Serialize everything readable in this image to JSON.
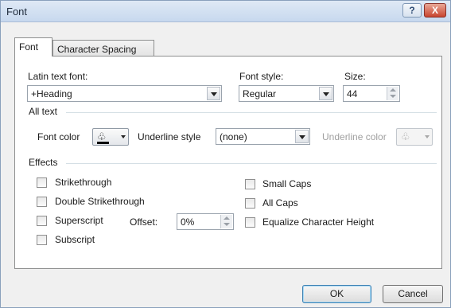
{
  "window": {
    "title": "Font",
    "help_label": "?",
    "close_label": "X"
  },
  "tabs": [
    {
      "label": "Font",
      "mnemonic": "n"
    },
    {
      "label": "Character Spacing",
      "mnemonic": "r"
    }
  ],
  "font": {
    "latin_label": "Latin text font:",
    "latin_value": "+Heading",
    "style_label": "Font style:",
    "style_value": "Regular",
    "size_label": "Size:",
    "size_value": "44"
  },
  "all_text": {
    "section_label": "All text",
    "font_color_label": "Font color",
    "underline_style_label": "Underline style",
    "underline_style_value": "(none)",
    "underline_color_label": "Underline color"
  },
  "effects": {
    "section_label": "Effects",
    "items": [
      {
        "label": "Strikethrough",
        "checked": false
      },
      {
        "label": "Double Strikethrough",
        "checked": false
      },
      {
        "label": "Superscript",
        "checked": false
      },
      {
        "label": "Subscript",
        "checked": false
      },
      {
        "label": "Small Caps",
        "checked": false
      },
      {
        "label": "All Caps",
        "checked": false
      },
      {
        "label": "Equalize Character Height",
        "checked": false
      }
    ],
    "offset_label": "Offset:",
    "offset_value": "0%"
  },
  "buttons": {
    "ok": "OK",
    "cancel": "Cancel"
  },
  "colors": {
    "font_color_swatch": "#000000",
    "close_red": "#c8442f"
  },
  "icons": {
    "font_color": "paint-bucket-icon",
    "underline_color": "paint-bucket-icon"
  }
}
